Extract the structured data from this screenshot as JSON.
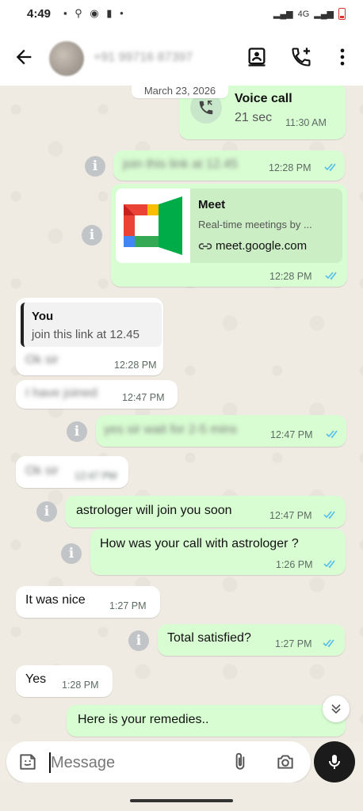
{
  "status_bar": {
    "time": "4:49",
    "network": "4G"
  },
  "header": {
    "contact_name": "+91 99716 87397"
  },
  "chat": {
    "date_chip": "March 23, 2026",
    "voice_call": {
      "title": "Voice call",
      "duration": "21 sec",
      "time": "11:30 AM"
    },
    "messages": [
      {
        "text": "join this link at 12.45",
        "time": "12:28 PM"
      },
      {
        "link_title": "Meet",
        "link_desc": "Real-time meetings by ...",
        "link_url": "meet.google.com",
        "time": "12:28 PM"
      },
      {
        "quote_author": "You",
        "quote_text": "join this link at 12.45",
        "text": "Ok sir",
        "time": "12:28 PM"
      },
      {
        "text": "I have joined",
        "time": "12:47 PM"
      },
      {
        "text": "yes sir wait for 2-5 mins",
        "time": "12:47 PM"
      },
      {
        "text": "Ok sir",
        "time": "12:47 PM"
      },
      {
        "text": "astrologer will join you soon",
        "time": "12:47 PM"
      },
      {
        "text": "How was your call with astrologer ?",
        "time": "1:26 PM"
      },
      {
        "text": "It was nice",
        "time": "1:27 PM"
      },
      {
        "text": "Total satisfied?",
        "time": "1:27 PM"
      },
      {
        "text": "Yes",
        "time": "1:28 PM"
      },
      {
        "text": "Here is your remedies.."
      }
    ]
  },
  "input": {
    "placeholder": "Message"
  },
  "colors": {
    "outgoing_bubble": "#d9fdd3",
    "incoming_bubble": "#ffffff",
    "read_ticks": "#53bdeb",
    "mic_button": "#1b1b1b"
  },
  "icons": [
    "back-arrow-icon",
    "contact-card-icon",
    "add-call-icon",
    "more-vert-icon",
    "call-icon",
    "info-icon",
    "link-icon",
    "double-tick-icon",
    "scroll-down-icon",
    "sticker-icon",
    "attach-icon",
    "camera-icon",
    "mic-icon"
  ]
}
